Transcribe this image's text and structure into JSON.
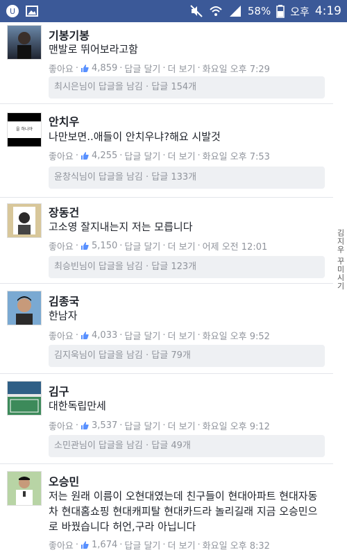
{
  "statusbar": {
    "battery": "58%",
    "ampm": "오후",
    "time": "4:19"
  },
  "comments": [
    {
      "name": "기봉기봉",
      "text": "맨발로 뛰어보라고함",
      "like": "좋아요",
      "count": "4,859",
      "reply": "답글 달기",
      "more": "더 보기",
      "time": "화요일 오후 7:29",
      "reply_box": "최시은님이 답글을 남김 · 답글 154개",
      "avatar_colors": [
        "#6a87a8",
        "#1f2430"
      ]
    },
    {
      "name": "안치우",
      "text": "나만보면..애들이 안치우냐?해요 시발것",
      "like": "좋아요",
      "count": "4,255",
      "reply": "답글 달기",
      "more": "더 보기",
      "time": "화요일 오후 7:53",
      "reply_box": "윤창식님이 답글을 남김 · 답글 133개",
      "avatar_label": "을 하나야",
      "avatar_colors": [
        "#000000",
        "#ffffff"
      ]
    },
    {
      "name": "장동건",
      "text": "고소영 잘지내는지 저는 모릅니다",
      "like": "좋아요",
      "count": "5,150",
      "reply": "답글 달기",
      "more": "더 보기",
      "time": "어제 오전 12:01",
      "reply_box": "최승빈님이 답글을 남김 · 답글 123개",
      "avatar_colors": [
        "#d8c79a",
        "#ffffff"
      ]
    },
    {
      "name": "김종국",
      "text": "한남자",
      "like": "좋아요",
      "count": "4,033",
      "reply": "답글 달기",
      "more": "더 보기",
      "time": "화요일 오후 9:52",
      "reply_box": "김지욱님이 답글을 남김 · 답글 79개",
      "avatar_colors": [
        "#7aa9d2",
        "#2b2a2a"
      ]
    },
    {
      "name": "김구",
      "text": "대한독립만세",
      "like": "좋아요",
      "count": "3,537",
      "reply": "답글 달기",
      "more": "더 보기",
      "time": "화요일 오후 9:12",
      "reply_box": "소민관님이 답글을 남김 · 답글 49개",
      "avatar_colors": [
        "#3c7aa6",
        "#2a6d4a"
      ]
    },
    {
      "name": "오승민",
      "text": "저는 원래 이름이 오현대였는데 친구들이 현대아파트 현대자동차 현대홈쇼핑 현대캐피탈 현대카드라 놀리길래 지금 오승민으로 바꿨습니다 허언,구라 아닙니다",
      "like": "좋아요",
      "count": "1,674",
      "reply": "답글 달기",
      "more": "더 보기",
      "time": "화요일 오후 8:32",
      "avatar_colors": [
        "#b8d4a5",
        "#ffffff"
      ]
    }
  ],
  "watermark": "김지우 꾸미시기"
}
